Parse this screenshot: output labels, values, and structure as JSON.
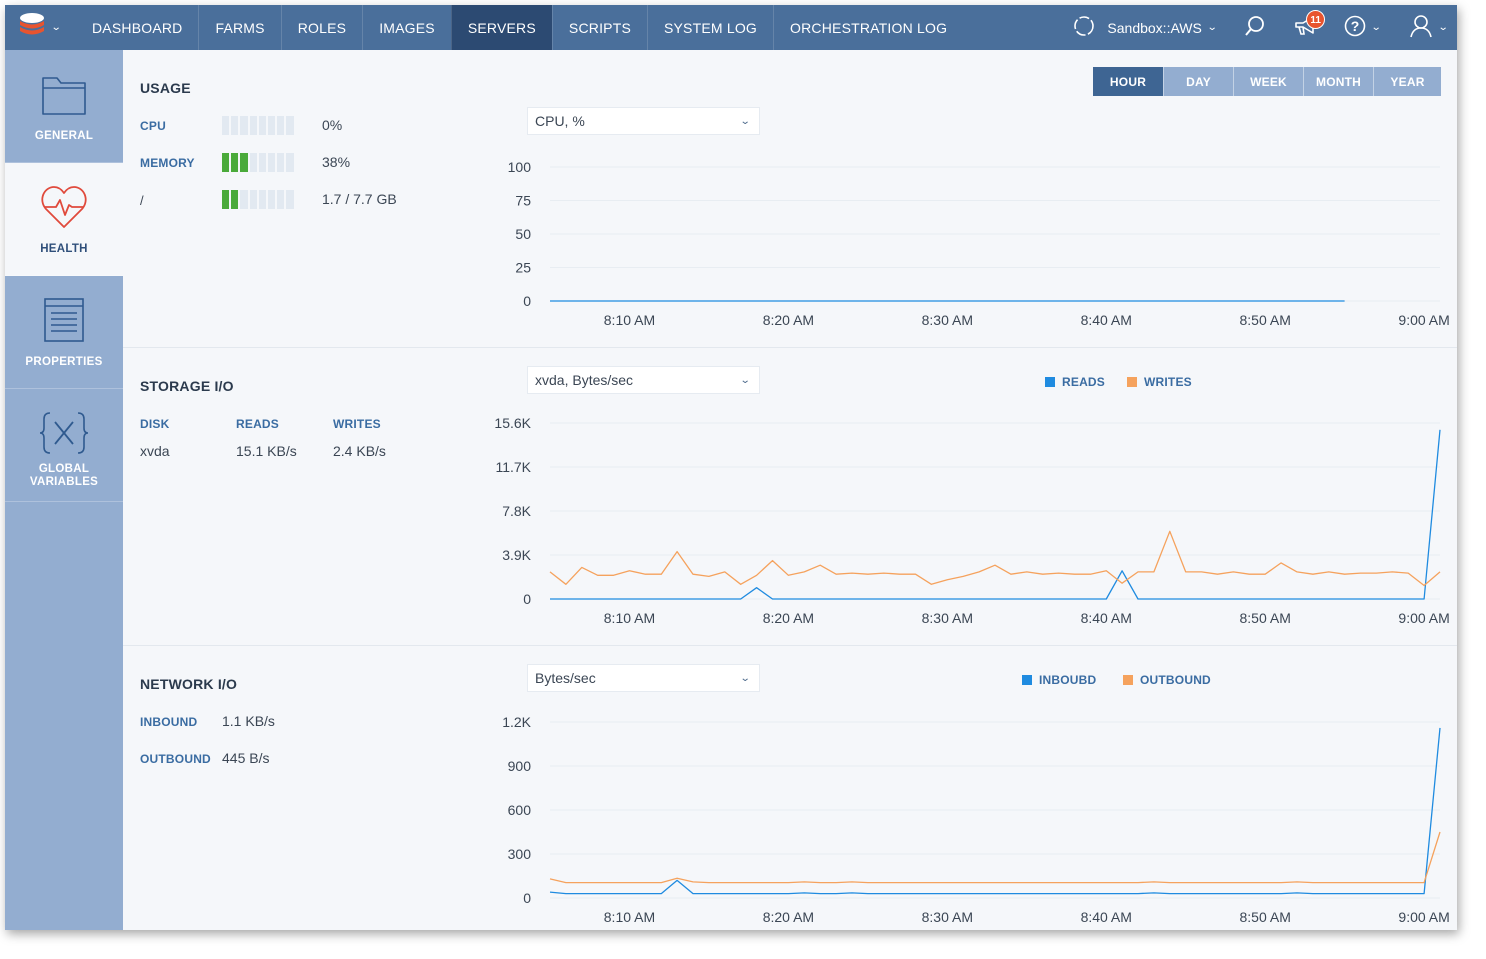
{
  "colors": {
    "topbar": "#4a6f9b",
    "nav_active": "#2c4a72",
    "sidebar": "#93add0",
    "accent_blue": "#1f8be0",
    "accent_orange": "#f5a25d",
    "meter_green": "#4aaa3a",
    "badge": "#e8542f"
  },
  "topbar": {
    "logo_icon": "stack-logo-icon",
    "nav": [
      "DASHBOARD",
      "FARMS",
      "ROLES",
      "IMAGES",
      "SERVERS",
      "SCRIPTS",
      "SYSTEM LOG",
      "ORCHESTRATION LOG"
    ],
    "active_nav": "SERVERS",
    "environment": "Sandbox::AWS",
    "notifications_count": "11"
  },
  "sidebar": {
    "items": [
      {
        "label": "GENERAL",
        "icon": "folder-icon"
      },
      {
        "label": "HEALTH",
        "icon": "heart-pulse-icon"
      },
      {
        "label": "PROPERTIES",
        "icon": "document-icon"
      },
      {
        "label": "GLOBAL\nVARIABLES",
        "icon": "variable-braces-icon"
      }
    ],
    "active": "HEALTH"
  },
  "range": {
    "options": [
      "HOUR",
      "DAY",
      "WEEK",
      "MONTH",
      "YEAR"
    ],
    "active": "HOUR"
  },
  "usage": {
    "title": "USAGE",
    "rows": [
      {
        "label": "CPU",
        "value": "0%",
        "segments_on": 0
      },
      {
        "label": "MEMORY",
        "value": "38%",
        "segments_on": 3
      },
      {
        "label": "/",
        "value": "1.7 / 7.7 GB",
        "segments_on": 2
      }
    ],
    "segments_total": 8,
    "metric_select": "CPU, %"
  },
  "storage": {
    "title": "STORAGE I/O",
    "headers": [
      "DISK",
      "READS",
      "WRITES"
    ],
    "rows": [
      {
        "disk": "xvda",
        "reads": "15.1 KB/s",
        "writes": "2.4 KB/s"
      }
    ],
    "metric_select": "xvda, Bytes/sec",
    "legend": [
      "READS",
      "WRITES"
    ]
  },
  "network": {
    "title": "NETWORK I/O",
    "inbound_label": "INBOUND",
    "inbound_value": "1.1 KB/s",
    "outbound_label": "OUTBOUND",
    "outbound_value": "445 B/s",
    "metric_select": "Bytes/sec",
    "legend": [
      "INBOUBD",
      "OUTBOUND"
    ]
  },
  "chart_data": [
    {
      "type": "line",
      "title": "CPU, %",
      "x_labels": [
        "8:10 AM",
        "8:20 AM",
        "8:30 AM",
        "8:40 AM",
        "8:50 AM",
        "9:00 AM"
      ],
      "x_minutes_after_8": [
        10,
        20,
        30,
        40,
        50,
        60
      ],
      "x_range_minutes_after_8": [
        5,
        61
      ],
      "ylim": [
        0,
        100
      ],
      "y_ticks": [
        "0",
        "25",
        "50",
        "75",
        "100"
      ],
      "y_tick_values": [
        0,
        25,
        50,
        75,
        100
      ],
      "series": [
        {
          "color": "#1f8be0",
          "x": [
            5,
            55
          ],
          "values": [
            0,
            0
          ]
        }
      ]
    },
    {
      "type": "line",
      "title": "xvda, Bytes/sec",
      "x_labels": [
        "8:10 AM",
        "8:20 AM",
        "8:30 AM",
        "8:40 AM",
        "8:50 AM",
        "9:00 AM"
      ],
      "x_minutes_after_8": [
        10,
        20,
        30,
        40,
        50,
        60
      ],
      "x_range_minutes_after_8": [
        5,
        61
      ],
      "ylim": [
        0,
        15600
      ],
      "y_ticks": [
        "0",
        "3.9K",
        "7.8K",
        "11.7K",
        "15.6K"
      ],
      "y_tick_values": [
        0,
        3900,
        7800,
        11700,
        15600
      ],
      "series": [
        {
          "name": "READS",
          "color": "#1f8be0",
          "x": [
            5,
            17,
            18,
            19,
            40,
            41,
            42,
            60,
            61
          ],
          "values": [
            0,
            0,
            1000,
            0,
            0,
            2500,
            0,
            0,
            15000
          ]
        },
        {
          "name": "WRITES",
          "color": "#f5a25d",
          "x": [
            5,
            6,
            7,
            8,
            9,
            10,
            11,
            12,
            13,
            14,
            15,
            16,
            17,
            18,
            19,
            20,
            21,
            22,
            23,
            24,
            25,
            26,
            27,
            28,
            29,
            30,
            31,
            32,
            33,
            34,
            35,
            36,
            37,
            38,
            39,
            40,
            41,
            42,
            43,
            44,
            45,
            46,
            47,
            48,
            49,
            50,
            51,
            52,
            53,
            54,
            55,
            56,
            57,
            58,
            59,
            60,
            61
          ],
          "values": [
            2400,
            1300,
            2800,
            2100,
            2100,
            2500,
            2200,
            2200,
            4200,
            2200,
            2000,
            2400,
            1300,
            2100,
            3400,
            2100,
            2400,
            3000,
            2200,
            2300,
            2200,
            2300,
            2200,
            2200,
            1300,
            1700,
            2000,
            2400,
            3000,
            2200,
            2400,
            2200,
            2300,
            2200,
            2200,
            2500,
            1400,
            2400,
            2400,
            6000,
            2400,
            2400,
            2200,
            2400,
            2200,
            2200,
            3200,
            2400,
            2200,
            2400,
            2200,
            2300,
            2300,
            2400,
            2300,
            1200,
            2400
          ]
        }
      ]
    },
    {
      "type": "line",
      "title": "Bytes/sec",
      "x_labels": [
        "8:10 AM",
        "8:20 AM",
        "8:30 AM",
        "8:40 AM",
        "8:50 AM",
        "9:00 AM"
      ],
      "x_minutes_after_8": [
        10,
        20,
        30,
        40,
        50,
        60
      ],
      "x_range_minutes_after_8": [
        5,
        61
      ],
      "ylim": [
        0,
        1200
      ],
      "y_ticks": [
        "0",
        "300",
        "600",
        "900",
        "1.2K"
      ],
      "y_tick_values": [
        0,
        300,
        600,
        900,
        1200
      ],
      "series": [
        {
          "name": "INBOUBD",
          "color": "#1f8be0",
          "x": [
            5,
            6,
            7,
            8,
            9,
            10,
            11,
            12,
            13,
            14,
            15,
            16,
            17,
            18,
            19,
            20,
            21,
            22,
            23,
            24,
            25,
            26,
            27,
            28,
            29,
            30,
            31,
            32,
            33,
            34,
            35,
            36,
            37,
            38,
            39,
            40,
            41,
            42,
            43,
            44,
            45,
            46,
            47,
            48,
            49,
            50,
            51,
            52,
            53,
            54,
            55,
            56,
            57,
            58,
            59,
            60,
            61
          ],
          "values": [
            40,
            30,
            30,
            30,
            30,
            30,
            30,
            30,
            120,
            30,
            30,
            30,
            30,
            30,
            30,
            30,
            35,
            30,
            30,
            35,
            30,
            30,
            30,
            30,
            30,
            30,
            30,
            30,
            30,
            30,
            30,
            30,
            30,
            30,
            30,
            30,
            30,
            30,
            35,
            30,
            30,
            30,
            30,
            30,
            30,
            30,
            30,
            35,
            30,
            30,
            30,
            30,
            30,
            30,
            30,
            30,
            1160
          ]
        },
        {
          "name": "OUTBOUND",
          "color": "#f5a25d",
          "x": [
            5,
            6,
            7,
            8,
            9,
            10,
            11,
            12,
            13,
            14,
            15,
            16,
            17,
            18,
            19,
            20,
            21,
            22,
            23,
            24,
            25,
            26,
            27,
            28,
            29,
            30,
            31,
            32,
            33,
            34,
            35,
            36,
            37,
            38,
            39,
            40,
            41,
            42,
            43,
            44,
            45,
            46,
            47,
            48,
            49,
            50,
            51,
            52,
            53,
            54,
            55,
            56,
            57,
            58,
            59,
            60,
            61
          ],
          "values": [
            130,
            105,
            105,
            105,
            105,
            105,
            105,
            105,
            135,
            110,
            105,
            105,
            105,
            105,
            105,
            105,
            110,
            105,
            105,
            110,
            105,
            105,
            105,
            105,
            105,
            105,
            105,
            105,
            105,
            105,
            105,
            105,
            105,
            105,
            105,
            105,
            105,
            105,
            110,
            105,
            105,
            105,
            105,
            105,
            105,
            105,
            105,
            110,
            105,
            105,
            105,
            105,
            105,
            105,
            105,
            105,
            450
          ]
        }
      ]
    }
  ]
}
